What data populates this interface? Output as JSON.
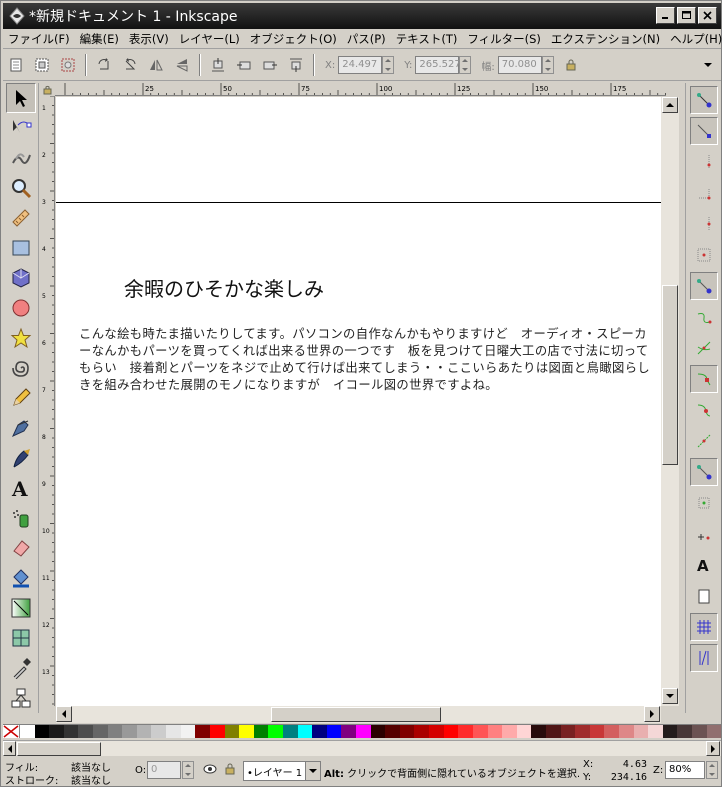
{
  "window": {
    "title": "*新規ドキュメント 1 - Inkscape"
  },
  "menu": [
    "ファイル(F)",
    "編集(E)",
    "表示(V)",
    "レイヤー(L)",
    "オブジェクト(O)",
    "パス(P)",
    "テキスト(T)",
    "フィルター(S)",
    "エクステンション(N)",
    "ヘルプ(H)"
  ],
  "toolctl": {
    "x_label": "X:",
    "x_value": "24.497",
    "y_label": "Y:",
    "y_value": "265.527",
    "w_label": "幅:",
    "w_value": "70.080"
  },
  "ruler_top": [
    "25",
    "50",
    "75",
    "100",
    "125",
    "150",
    "175"
  ],
  "ruler_left": [
    "1",
    "2",
    "3",
    "4",
    "5",
    "6",
    "7",
    "8",
    "9",
    "10",
    "11",
    "12",
    "13"
  ],
  "document": {
    "title": "余暇のひそかな楽しみ",
    "body": "こんな絵も時たま描いたりしてます。パソコンの自作なんかもやりますけど　オーディオ・スピーカーなんかもパーツを買ってくれば出来る世界の一つです　板を見つけて日曜大工の店で寸法に切ってもらい　接着剤とパーツをネジで止めて行けば出来てしまう・・ここいらあたりは図面と鳥瞰図らしきを組み合わせた展開のモノになりますが　イコール図の世界ですよね。"
  },
  "palette": [
    "#ffffff",
    "#000000",
    "#1a1a1a",
    "#333333",
    "#4d4d4d",
    "#666666",
    "#808080",
    "#999999",
    "#b3b3b3",
    "#cccccc",
    "#e6e6e6",
    "#f2f2f2",
    "#800000",
    "#ff0000",
    "#808000",
    "#ffff00",
    "#008000",
    "#00ff00",
    "#008080",
    "#00ffff",
    "#000080",
    "#0000ff",
    "#800080",
    "#ff00ff",
    "#2b0000",
    "#550000",
    "#800000",
    "#aa0000",
    "#d40000",
    "#ff0000",
    "#ff2a2a",
    "#ff5555",
    "#ff8080",
    "#ffaaaa",
    "#ffd5d5",
    "#280b0b",
    "#501616",
    "#782121",
    "#a02c2c",
    "#c83737",
    "#d35f5f",
    "#de8787",
    "#e9afaf",
    "#f4d7d7",
    "#241c1c",
    "#483737",
    "#6c5353",
    "#916f6f"
  ],
  "status": {
    "fill_label": "フィル:",
    "fill_value": "該当なし",
    "stroke_label": "ストローク:",
    "stroke_value": "該当なし",
    "opacity_label": "O:",
    "opacity_value": "0",
    "layer": "•レイヤー 1",
    "message_bold": "Alt:",
    "message": "クリックで背面側に隠れているオブジェクトを選択…",
    "cursor_x_label": "X:",
    "cursor_x": "4.63",
    "cursor_y_label": "Y:",
    "cursor_y": "234.16",
    "zoom_label": "Z:",
    "zoom": "80%"
  }
}
